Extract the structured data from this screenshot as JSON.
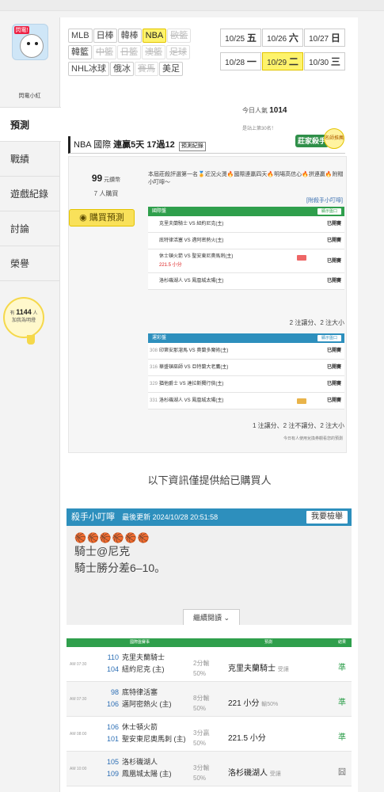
{
  "profile": {
    "name": "閃電小紅",
    "avatar_tag": "閃電!"
  },
  "nav": [
    "預測",
    "戰績",
    "遊戲紀錄",
    "討論",
    "榮譽"
  ],
  "likes": {
    "prefix": "有",
    "count": "1144",
    "suffix": "人",
    "sub": "加我為明燈"
  },
  "filters": [
    {
      "label": "MLB",
      "state": "normal"
    },
    {
      "label": "日棒",
      "state": "normal"
    },
    {
      "label": "韓棒",
      "state": "normal"
    },
    {
      "label": "NBA",
      "state": "active"
    },
    {
      "label": "歐籃",
      "state": "muted"
    },
    {
      "label": "韓籃",
      "state": "normal"
    },
    {
      "label": "中籃",
      "state": "muted"
    },
    {
      "label": "日籃",
      "state": "muted"
    },
    {
      "label": "澳籃",
      "state": "muted"
    },
    {
      "label": "足球",
      "state": "muted"
    },
    {
      "label": "NHL冰球",
      "state": "normal"
    },
    {
      "label": "俄冰",
      "state": "normal"
    },
    {
      "label": "賽馬",
      "state": "muted"
    },
    {
      "label": "美足",
      "state": "normal"
    }
  ],
  "dates": [
    {
      "date": "10/25",
      "day": "五",
      "active": false
    },
    {
      "date": "10/26",
      "day": "六",
      "active": false
    },
    {
      "date": "10/27",
      "day": "日",
      "active": false
    },
    {
      "date": "10/28",
      "day": "一",
      "active": false
    },
    {
      "date": "10/29",
      "day": "二",
      "active": true
    },
    {
      "date": "10/30",
      "day": "三",
      "active": false
    }
  ],
  "popularity": {
    "label": "今日人氣",
    "value": "1014"
  },
  "rank_text": "是站上第30名！",
  "badge": {
    "main": "莊家殺手",
    "sub": "NBA國際盤",
    "medal": "名師推薦"
  },
  "title": {
    "prefix": "NBA 國際",
    "streak": "連贏5天 17過12",
    "record": "預測紀錄"
  },
  "stats": {
    "price": "99",
    "price_unit": "元鑽幣",
    "buyers": "7 人購買"
  },
  "buy_label": "購買預測",
  "description": "本屆莊殺評選第一名🏅近況火燙🔥國際連贏四天🔥明場高信心🔥拼連贏🔥附贈小叮嚀～",
  "tip_link": "[附殺手小叮嚀]",
  "intl": {
    "header": "國際盤",
    "show": "顯示盤口",
    "rows": [
      {
        "match": "克里夫蘭騎士",
        "opp": "紐約尼克(主)",
        "res": "已開賽"
      },
      {
        "match": "底特律活塞",
        "opp": "邁阿密熱火(主)",
        "res": "已開賽"
      },
      {
        "match": "休士頓火箭",
        "opp": "聖安東尼奧馬刺(主)",
        "extra": "221.5 小分",
        "res": "已開賽"
      },
      {
        "match": "洛杉磯湖人",
        "opp": "鳳凰城太陽(主)",
        "res": "已開賽"
      }
    ],
    "summary": "2 注讓分、2 注大小"
  },
  "sports": {
    "header": "運彩盤",
    "show": "顯示盤口",
    "rows": [
      {
        "num": "308",
        "match": "印第安那溜馬",
        "opp": "奧蘭多魔術(主)",
        "res": "已開賽"
      },
      {
        "num": "316",
        "match": "華盛頓巫師",
        "opp": "亞特蘭大老鷹(主)",
        "res": "已開賽"
      },
      {
        "num": "329",
        "match": "猶他爵士",
        "opp": "達拉斯獨行俠(主)",
        "res": "已開賽"
      },
      {
        "num": "331",
        "match": "洛杉磯湖人",
        "opp": "鳳凰城太陽(主)",
        "res": "已開賽"
      }
    ],
    "summary": "1 注讓分、2 注不讓分、2 注大小"
  },
  "note": "今日有人使用兌換券觀看您的預測",
  "purchased_text": "以下資訊僅提供給已購買人",
  "tip": {
    "title": "殺手小叮嚀",
    "updated": "最後更新 2024/10/28 20:51:58",
    "report": "我要檢舉",
    "balls": "🏀🏀🏀🏀🏀🏀",
    "line1": "騎士@尼克",
    "line2": "騎士勝分差6–10。",
    "more": "繼續閱讀 ⌄"
  },
  "results": {
    "headers": {
      "games": "國際盤賽事",
      "pick": "預測",
      "grade": "結果"
    },
    "rows": [
      {
        "time": "AM 07:30",
        "n1": "110",
        "t1": "克里夫蘭騎士",
        "n2": "104",
        "t2": "紐約尼克 (主)",
        "l1": "2分輸",
        "l2": "50%",
        "pick": "克里夫蘭騎士",
        "pick_note": "受讓",
        "grade": "準"
      },
      {
        "time": "AM 07:30",
        "n1": "98",
        "t1": "底特律活塞",
        "n2": "106",
        "t2": "邁阿密熱火 (主)",
        "l1": "8分輸",
        "l2": "50%",
        "pick": "221 小分",
        "pick_note": "輸50%",
        "grade": "準"
      },
      {
        "time": "AM 08:00",
        "n1": "106",
        "t1": "休士頓火箭",
        "n2": "101",
        "t2": "聖安東尼奧馬刺 (主)",
        "l1": "3分贏",
        "l2": "50%",
        "pick": "221.5 小分",
        "pick_note": "",
        "grade": "準"
      },
      {
        "time": "AM 10:00",
        "n1": "105",
        "t1": "洛杉磯湖人",
        "n2": "109",
        "t2": "鳳凰城太陽 (主)",
        "l1": "3分輸",
        "l2": "50%",
        "pick": "洛杉磯湖人",
        "pick_note": "受讓",
        "grade": "囧"
      }
    ]
  },
  "colors": {
    "accent_yellow": "#fef36b",
    "blue": "#2d8fbd",
    "green": "#2f9f4c"
  }
}
